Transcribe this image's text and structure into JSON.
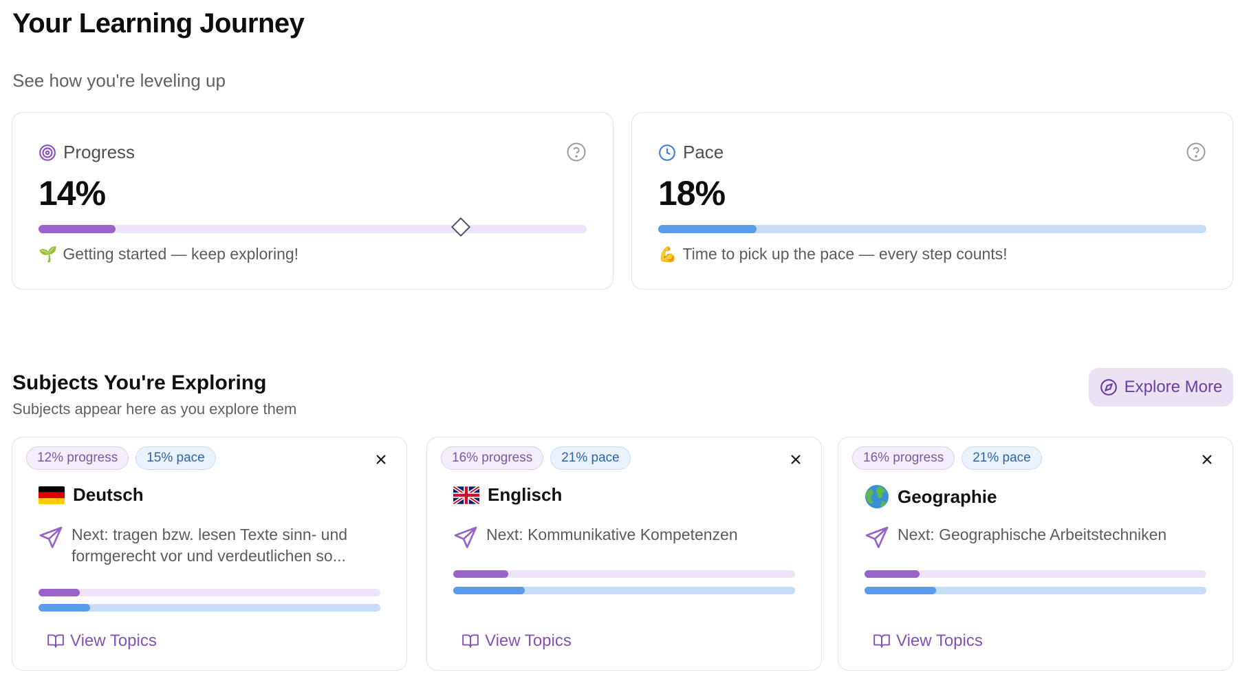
{
  "header": {
    "title": "Your Learning Journey",
    "subtitle": "See how you're leveling up"
  },
  "stats": {
    "progress": {
      "label": "Progress",
      "value_text": "14%",
      "value": 14,
      "marker": 77,
      "message": "Getting started — keep exploring!",
      "emoji": "🌱",
      "icon": "target-icon",
      "track_color": "#eee4f7",
      "fill_color": "#9b62cc"
    },
    "pace": {
      "label": "Pace",
      "value_text": "18%",
      "value": 18,
      "message": "Time to pick up the pace — every step counts!",
      "emoji": "💪",
      "icon": "clock-icon",
      "track_color": "#c6ddf8",
      "fill_color": "#5b9bec"
    }
  },
  "subjects_section": {
    "title": "Subjects You're Exploring",
    "subtitle": "Subjects appear here as you explore them",
    "explore_button": "Explore More"
  },
  "subjects": [
    {
      "progress_badge": "12% progress",
      "pace_badge": "15% pace",
      "name": "Deutsch",
      "flag": "de-flag",
      "next": "Next: tragen bzw. lesen Texte sinn- und formgerecht vor und verdeutlichen so...",
      "progress": 12,
      "pace": 15,
      "view_topics": "View Topics"
    },
    {
      "progress_badge": "16% progress",
      "pace_badge": "21% pace",
      "name": "Englisch",
      "flag": "uk-flag",
      "next": "Next: Kommunikative Kompetenzen",
      "progress": 16,
      "pace": 21,
      "view_topics": "View Topics"
    },
    {
      "progress_badge": "16% progress",
      "pace_badge": "21% pace",
      "name": "Geographie",
      "flag": "globe-icon",
      "next": "Next: Geographische Arbeitstechniken",
      "progress": 16,
      "pace": 21,
      "view_topics": "View Topics"
    }
  ]
}
